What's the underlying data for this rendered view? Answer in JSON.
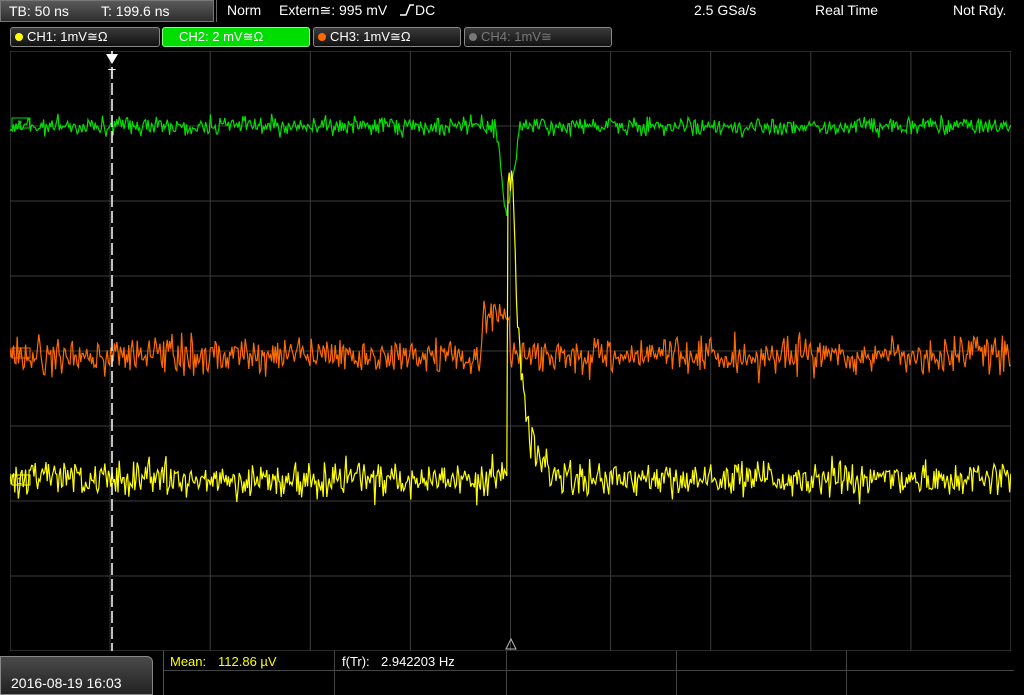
{
  "status": {
    "timebase": "TB: 50 ns",
    "trigger_time": "T: 199.6 ns",
    "trigger_mode": "Norm",
    "trigger_source": "Extern≅: 995 mV",
    "trigger_coupling": "DC",
    "sample_rate": "2.5 GSa/s",
    "acq_mode": "Real Time",
    "state": "Not Rdy."
  },
  "channels": [
    {
      "label": "CH1: 1mV",
      "coupling": "≅Ω",
      "color": "#ffff00",
      "active": false,
      "enabled": true
    },
    {
      "label": "CH2: 2 mV",
      "coupling": "≅Ω",
      "color": "#00e000",
      "active": true,
      "enabled": true
    },
    {
      "label": "CH3: 1mV",
      "coupling": "≅Ω",
      "color": "#ff6a00",
      "active": false,
      "enabled": true
    },
    {
      "label": "CH4: 1mV",
      "coupling": "≅",
      "color": "#777777",
      "active": false,
      "enabled": false
    }
  ],
  "measurements": {
    "mean_label": "Mean:",
    "mean_value": "112.86 µV",
    "freq_label": "f(Tr):",
    "freq_value": "2.942203 Hz"
  },
  "datetime": "2016-08-19 16:03",
  "trigger_marker": "T",
  "channel_markers": {
    "ch1": "1",
    "ch2": "2",
    "ch3": "3"
  },
  "colors": {
    "ch1": "#ffff00",
    "ch2": "#00e000",
    "ch3": "#ff6a00",
    "grid": "#3c3c3c",
    "active_tab": "#00dd00"
  }
}
